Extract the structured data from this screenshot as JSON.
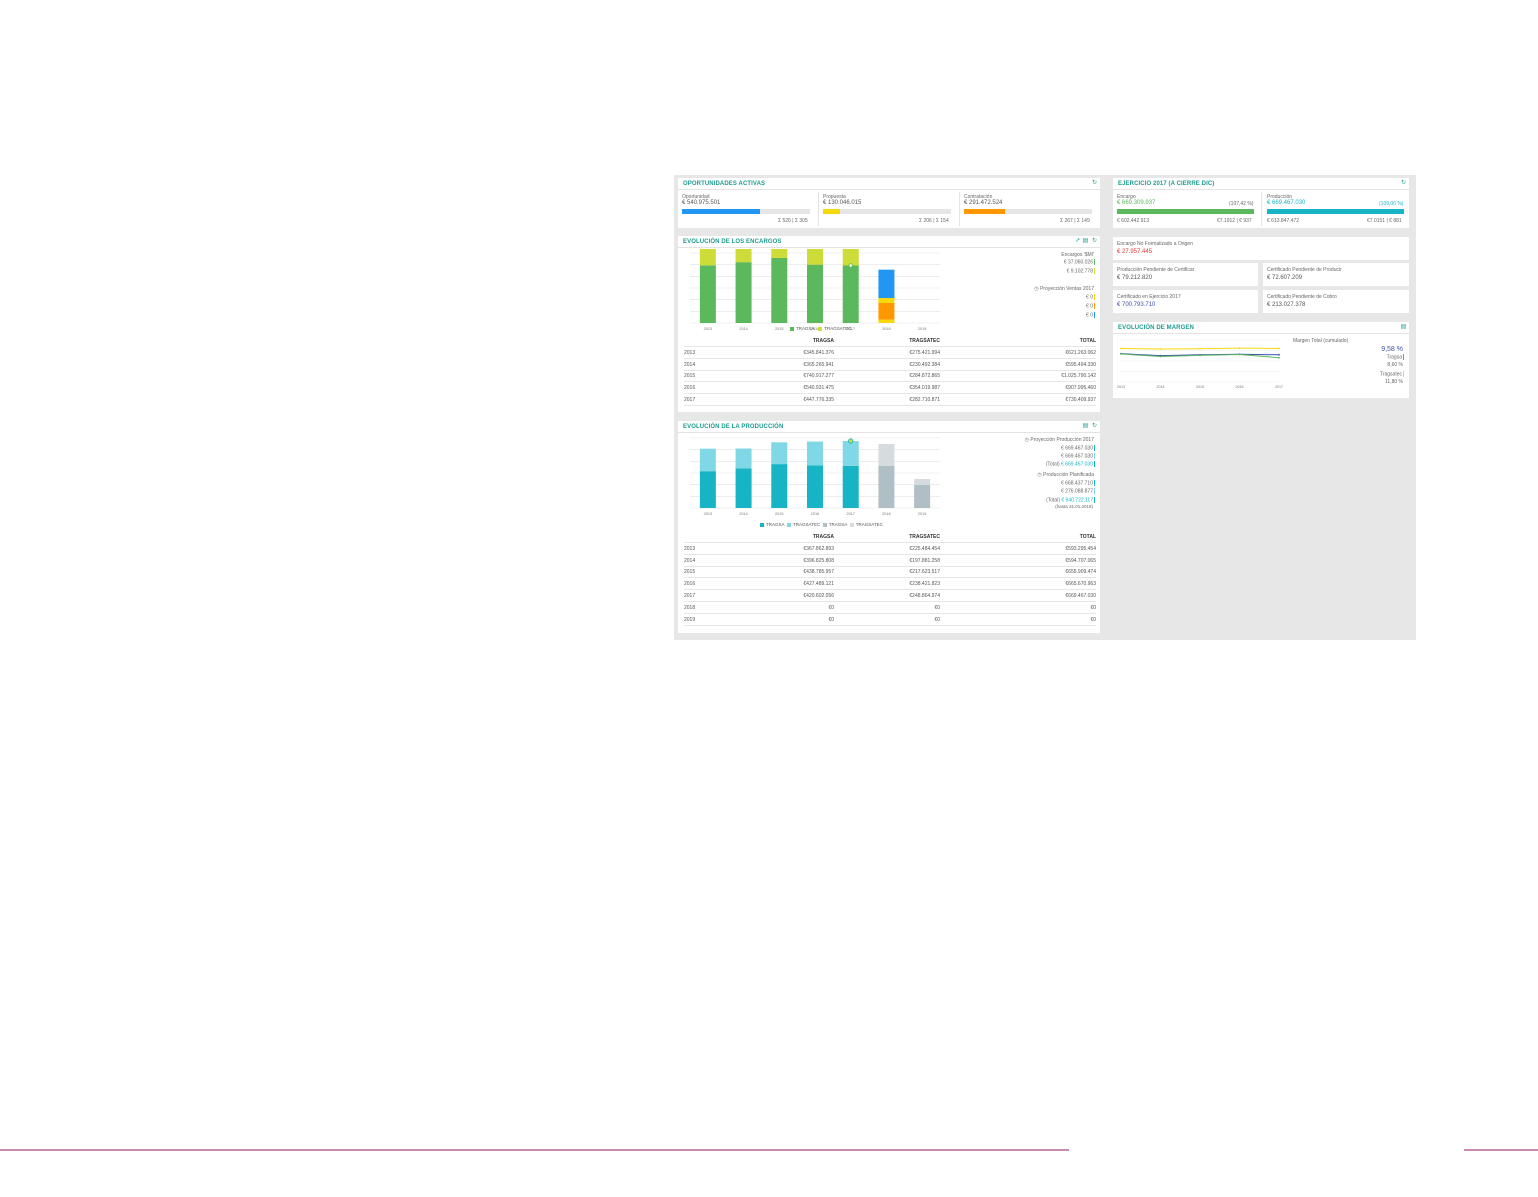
{
  "opportunities": {
    "title": "OPORTUNIDADES ACTIVAS",
    "items": [
      {
        "label": "Oportunidad",
        "amount": "€ 540.975.501",
        "sub": "Σ 520 | Σ 305",
        "fill": 0.61,
        "color": "#2196f3"
      },
      {
        "label": "Propuesta",
        "amount": "€ 130.046.015",
        "sub": "Σ 206 | Σ 154",
        "fill": 0.13,
        "color": "#f5d90a"
      },
      {
        "label": "Contratación",
        "amount": "€ 291.472.524",
        "sub": "Σ 267 | Σ 149",
        "fill": 0.32,
        "color": "#ff9800"
      }
    ]
  },
  "fiscal": {
    "title": "EJERCICIO 2017 (A CIERRE DIC)",
    "encargo": {
      "label": "Encargo",
      "amount": "€ 669.309.937",
      "pct": "(107,42 %)",
      "left": "€ 602.442.913",
      "right": "€7.1912 | € 937",
      "fill": 1.0,
      "color": "#5cb85c"
    },
    "produccion": {
      "label": "Producción",
      "amount": "€ 669.467.030",
      "pct": "(109,06 %)",
      "left": "€ 613.847.472",
      "right": "€7.0151 | € 881",
      "fill": 1.0,
      "color": "#17b4c6"
    }
  },
  "encargos": {
    "title": "EVOLUCIÓN DE LOS ENCARGOS",
    "legend": [
      {
        "name": "TRAGSA",
        "color": "#5cb85c"
      },
      {
        "name": "TRAGSATEC",
        "color": "#cddc39"
      }
    ],
    "side": {
      "head1": "Encargos '$MI'",
      "v1": "€ 37.060.026",
      "v2": "€ 9.102.778",
      "head2": "Proyección Ventas 2017",
      "v3": "€ 0",
      "v4": "€ 0",
      "v5": "€ 0"
    },
    "table": {
      "headers": [
        "",
        "TRAGSA",
        "TRAGSATEC",
        "TOTAL"
      ],
      "rows": [
        [
          "2013",
          "€345.841.376",
          "€275.421.994",
          "€621.263.062"
        ],
        [
          "2014",
          "€365.265.941",
          "€230.492.384",
          "€595.494.330"
        ],
        [
          "2015",
          "€740.917.277",
          "€284.872.865",
          "€1.025.790.142"
        ],
        [
          "2016",
          "€540.931.475",
          "€354.019.987",
          "€907.995.460"
        ],
        [
          "2017",
          "€447.776.335",
          "€282.710.871",
          "€730.409.937"
        ]
      ]
    }
  },
  "indicators": {
    "enc_no_form": {
      "label": "Encargo No Formalizado a Origen",
      "value": "€ 27.957.445",
      "color": "#e53935"
    },
    "prod_pend_cert": {
      "label": "Producción Pendiente de Certificar",
      "value": "€ 79.212.820",
      "color": "#555555"
    },
    "cert_pend_prod": {
      "label": "Certificado Pendiente de Producir",
      "value": "€ 72.607.209",
      "color": "#555555"
    },
    "cert_ejercicio": {
      "label": "Certificado en Ejercicio 2017",
      "value": "€ 700.793.710",
      "color": "#3f51b5"
    },
    "cert_pend_cobro": {
      "label": "Certificado Pendiente de Cobro",
      "value": "€ 213.027.378",
      "color": "#555555"
    }
  },
  "margen": {
    "title": "EVOLUCIÓN DE MARGEN",
    "side_title": "Margen Total (cumulado)",
    "total": "9,58 %",
    "l1": "Tragsa",
    "v1": "8,60 %",
    "l2": "Tragsatec",
    "v2": "11,80 %",
    "years": [
      "2013",
      "2014",
      "2015",
      "2016",
      "2017"
    ]
  },
  "produccion": {
    "title": "EVOLUCIÓN DE LA PRODUCCIÓN",
    "legend": [
      {
        "name": "TRAGSA",
        "color": "#17b4c6"
      },
      {
        "name": "TRAGSATEC",
        "color": "#80d8e6"
      },
      {
        "name": "TRAGSA",
        "color": "#b0bec5"
      },
      {
        "name": "TRAGSATEC",
        "color": "#d5dbdf"
      }
    ],
    "side": {
      "head1": "Proyección Producción 2017",
      "v1": "€ 669.467.030",
      "v2": "€ 669.467.030",
      "total_label": "(Total)",
      "v3": "€ 669.467.030",
      "head2": "Producción Planificada",
      "v4": "€ 668.437.710",
      "v5": "€ 276.088.877",
      "v6": "€ 940.722.117",
      "note": "(hasta 31.01.2019)"
    },
    "table": {
      "headers": [
        "",
        "TRAGSA",
        "TRAGSATEC",
        "TOTAL"
      ],
      "rows": [
        [
          "2013",
          "€367.862.893",
          "€225.484.454",
          "€593.295.454"
        ],
        [
          "2014",
          "€396.825.808",
          "€197.881.258",
          "€594.707.065"
        ],
        [
          "2015",
          "€438.785.957",
          "€217.623.517",
          "€655.909.474"
        ],
        [
          "2016",
          "€427.489.121",
          "€238.421.823",
          "€665.670.963"
        ],
        [
          "2017",
          "€420.602.056",
          "€248.864.974",
          "€669.467.030"
        ],
        [
          "2018",
          "€0",
          "€0",
          "€0"
        ],
        [
          "2019",
          "€0",
          "€0",
          "€0"
        ]
      ]
    }
  },
  "chart_data": [
    {
      "type": "bar",
      "title": "EVOLUCIÓN DE LOS ENCARGOS",
      "categories": [
        "2013",
        "2014",
        "2015",
        "2016",
        "2017",
        "2018",
        "2019"
      ],
      "series": [
        {
          "name": "TRAGSA",
          "values": [
            346,
            365,
            390,
            350,
            345,
            0,
            0
          ],
          "color": "#5cb85c"
        },
        {
          "name": "TRAGSATEC",
          "values": [
            150,
            140,
            160,
            150,
            190,
            0,
            0
          ],
          "color": "#cddc39"
        },
        {
          "name": "",
          "values": [
            0,
            0,
            30,
            0,
            0,
            0,
            0
          ],
          "color": "#2196f3"
        }
      ],
      "extra_2018": [
        {
          "value": 20,
          "color": "#f5d90a"
        },
        {
          "value": 100,
          "color": "#ff9800"
        },
        {
          "value": 30,
          "color": "#f5d90a"
        },
        {
          "value": 170,
          "color": "#2196f3"
        }
      ],
      "ylim": [
        0,
        420
      ],
      "grid": true
    },
    {
      "type": "line",
      "title": "EVOLUCIÓN DE MARGEN",
      "x": [
        "2013",
        "2014",
        "2015",
        "2016",
        "2017"
      ],
      "series": [
        {
          "name": "Tragsatec",
          "values": [
            11.8,
            11.6,
            11.7,
            11.9,
            11.8
          ],
          "color": "#f5d90a"
        },
        {
          "name": "Total",
          "values": [
            10.0,
            9.3,
            9.6,
            9.8,
            9.6
          ],
          "color": "#3f51b5"
        },
        {
          "name": "Tragsa",
          "values": [
            9.9,
            9.0,
            9.4,
            9.7,
            8.6
          ],
          "color": "#5cb85c"
        }
      ],
      "ylim": [
        0,
        14
      ],
      "grid": true
    },
    {
      "type": "bar",
      "title": "EVOLUCIÓN DE LA PRODUCCIÓN",
      "categories": [
        "2013",
        "2014",
        "2015",
        "2016",
        "2017",
        "2018",
        "2019"
      ],
      "series": [
        {
          "name": "TRAGSA",
          "values": [
            368,
            397,
            439,
            427,
            421,
            0,
            0
          ],
          "color": "#17b4c6"
        },
        {
          "name": "TRAGSATEC",
          "values": [
            225,
            198,
            218,
            238,
            249,
            0,
            0
          ],
          "color": "#80d8e6"
        },
        {
          "name": "TRAGSA",
          "values": [
            0,
            0,
            0,
            0,
            0,
            420,
            230
          ],
          "color": "#b0bec5"
        },
        {
          "name": "TRAGSATEC",
          "values": [
            0,
            0,
            0,
            0,
            0,
            220,
            60
          ],
          "color": "#d5dbdf"
        }
      ],
      "ylim": [
        0,
        700
      ],
      "grid": true
    }
  ]
}
